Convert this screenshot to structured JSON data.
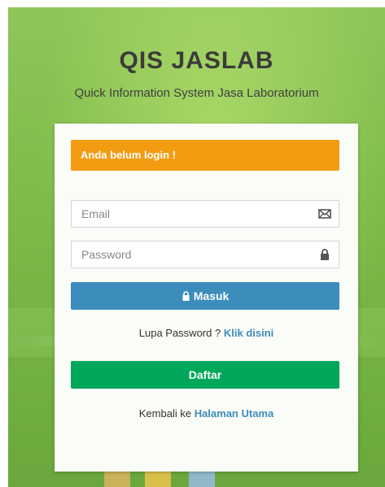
{
  "header": {
    "title": "QIS JASLAB",
    "subtitle": "Quick Information System Jasa Laboratorium"
  },
  "alert": {
    "text": "Anda belum login !"
  },
  "form": {
    "email_placeholder": "Email",
    "password_placeholder": "Password",
    "login_label": "Masuk",
    "forgot_prefix": "Lupa Password ?",
    "forgot_link": "Klik disini",
    "register_label": "Daftar",
    "back_prefix": "Kembali ke",
    "back_link": "Halaman Utama"
  },
  "icons": {
    "email": "envelope-icon",
    "password": "lock-icon",
    "login": "lock-icon"
  },
  "colors": {
    "alert": "#f39c12",
    "login_button": "#3c8dbc",
    "register_button": "#00a65a",
    "link": "#3c8dbc"
  }
}
